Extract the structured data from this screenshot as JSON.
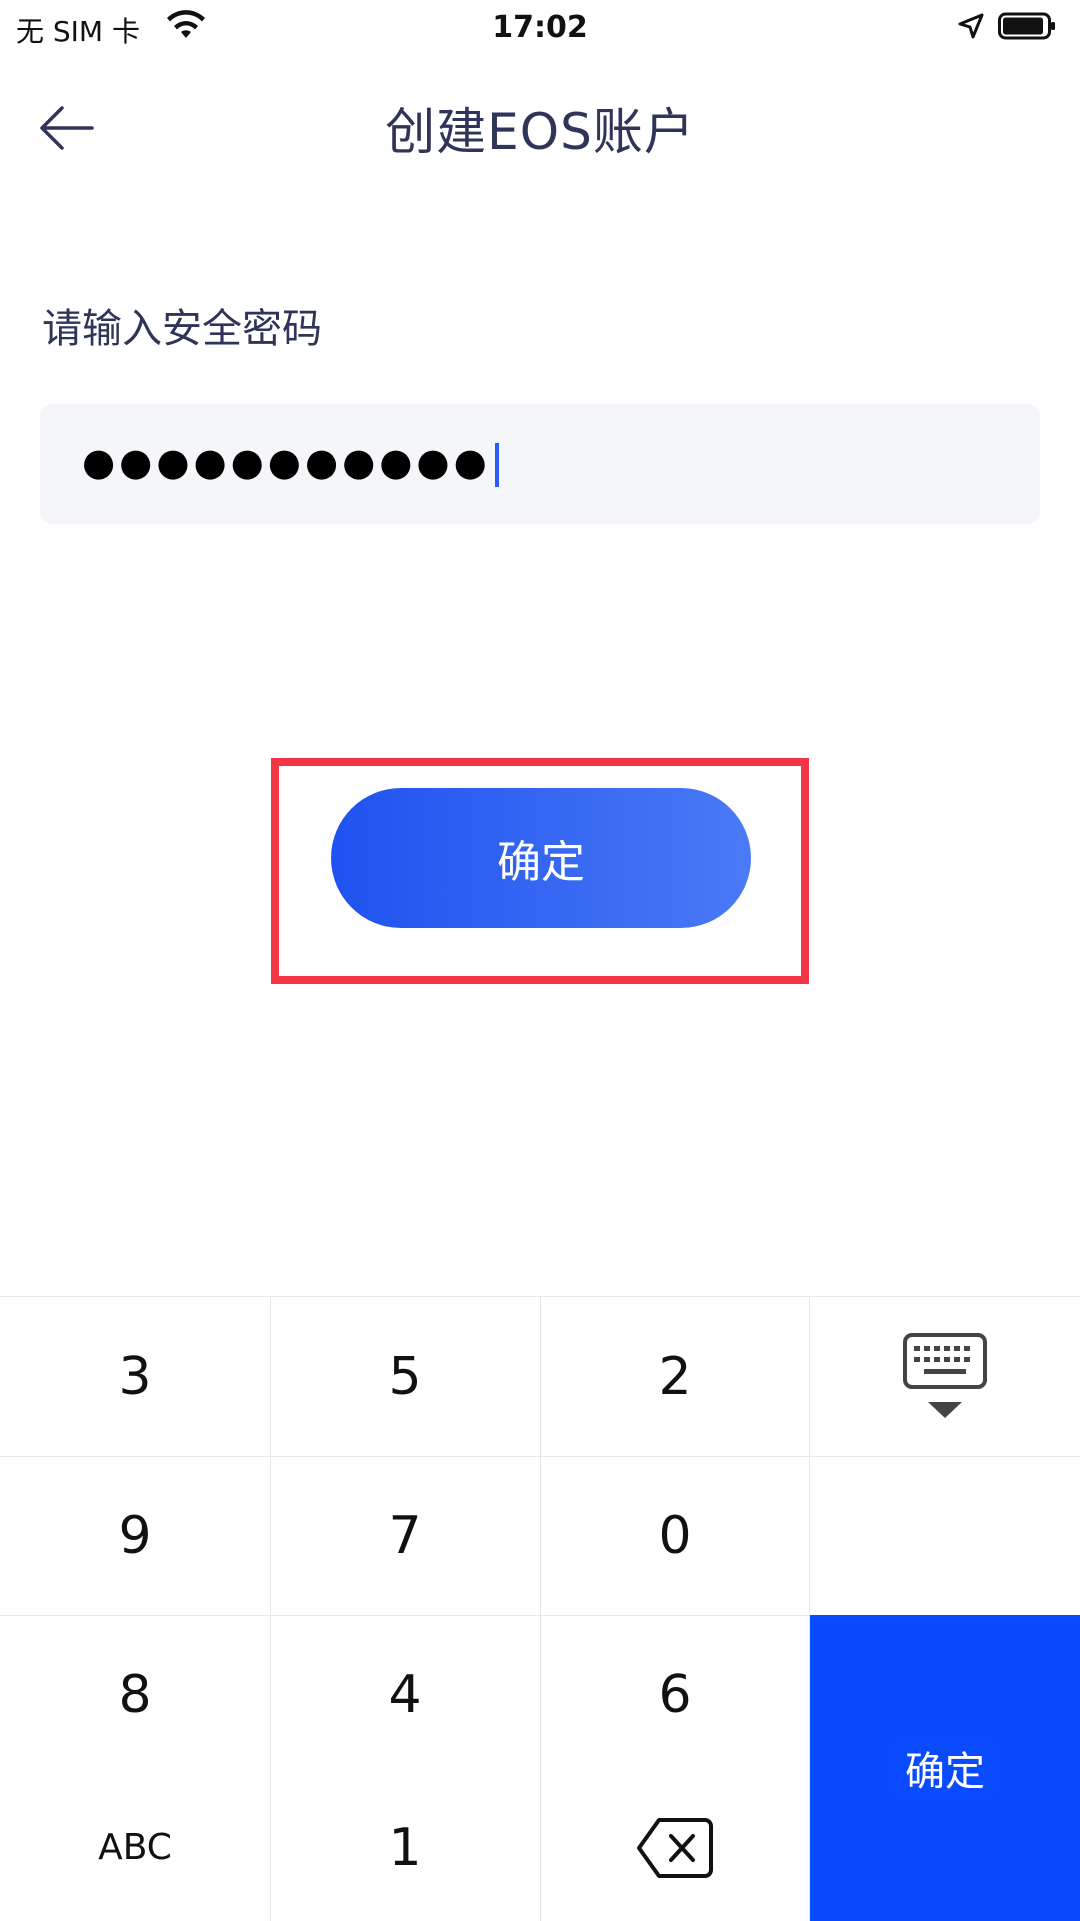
{
  "status_bar": {
    "carrier": "无 SIM 卡",
    "time": "17:02"
  },
  "header": {
    "title": "创建EOS账户"
  },
  "form": {
    "label": "请输入安全密码",
    "password_masked": "●●●●●●●●●●●"
  },
  "buttons": {
    "confirm_label": "确定"
  },
  "keyboard": {
    "rows": [
      [
        "3",
        "5",
        "2"
      ],
      [
        "9",
        "7",
        "0"
      ],
      [
        "8",
        "4",
        "6"
      ],
      [
        "ABC",
        "1"
      ]
    ],
    "confirm_label": "确定",
    "icons": {
      "hide": "keyboard-hide-icon",
      "delete": "backspace-icon"
    }
  },
  "colors": {
    "accent": "#0a4bff",
    "highlight": "#f23645",
    "title": "#2f3558"
  }
}
